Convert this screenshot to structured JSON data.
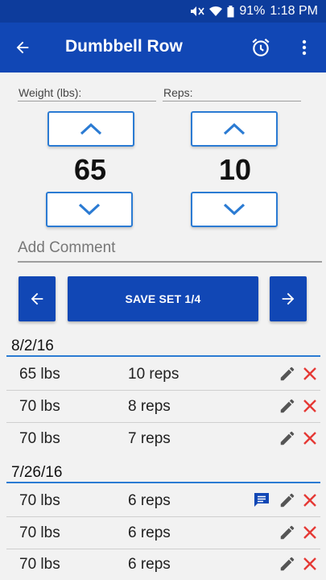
{
  "status_bar": {
    "battery": "91%",
    "time": "1:18 PM"
  },
  "app_bar": {
    "title": "Dumbbell Row"
  },
  "weight": {
    "label": "Weight (lbs):",
    "value": "65"
  },
  "reps": {
    "label": "Reps:",
    "value": "10"
  },
  "comment": {
    "placeholder": "Add Comment"
  },
  "save_button": {
    "label": "SAVE SET 1/4"
  },
  "colors": {
    "primary": "#1147b5",
    "accent": "#2b7bd3",
    "delete": "#e53935",
    "edit": "#555555"
  },
  "history": [
    {
      "date": "8/2/16",
      "sets": [
        {
          "weight": "65 lbs",
          "reps": "10 reps",
          "has_comment": false
        },
        {
          "weight": "70 lbs",
          "reps": "8 reps",
          "has_comment": false
        },
        {
          "weight": "70 lbs",
          "reps": "7 reps",
          "has_comment": false
        }
      ]
    },
    {
      "date": "7/26/16",
      "sets": [
        {
          "weight": "70 lbs",
          "reps": "6 reps",
          "has_comment": true
        },
        {
          "weight": "70 lbs",
          "reps": "6 reps",
          "has_comment": false
        },
        {
          "weight": "70 lbs",
          "reps": "6 reps",
          "has_comment": false
        }
      ]
    }
  ]
}
